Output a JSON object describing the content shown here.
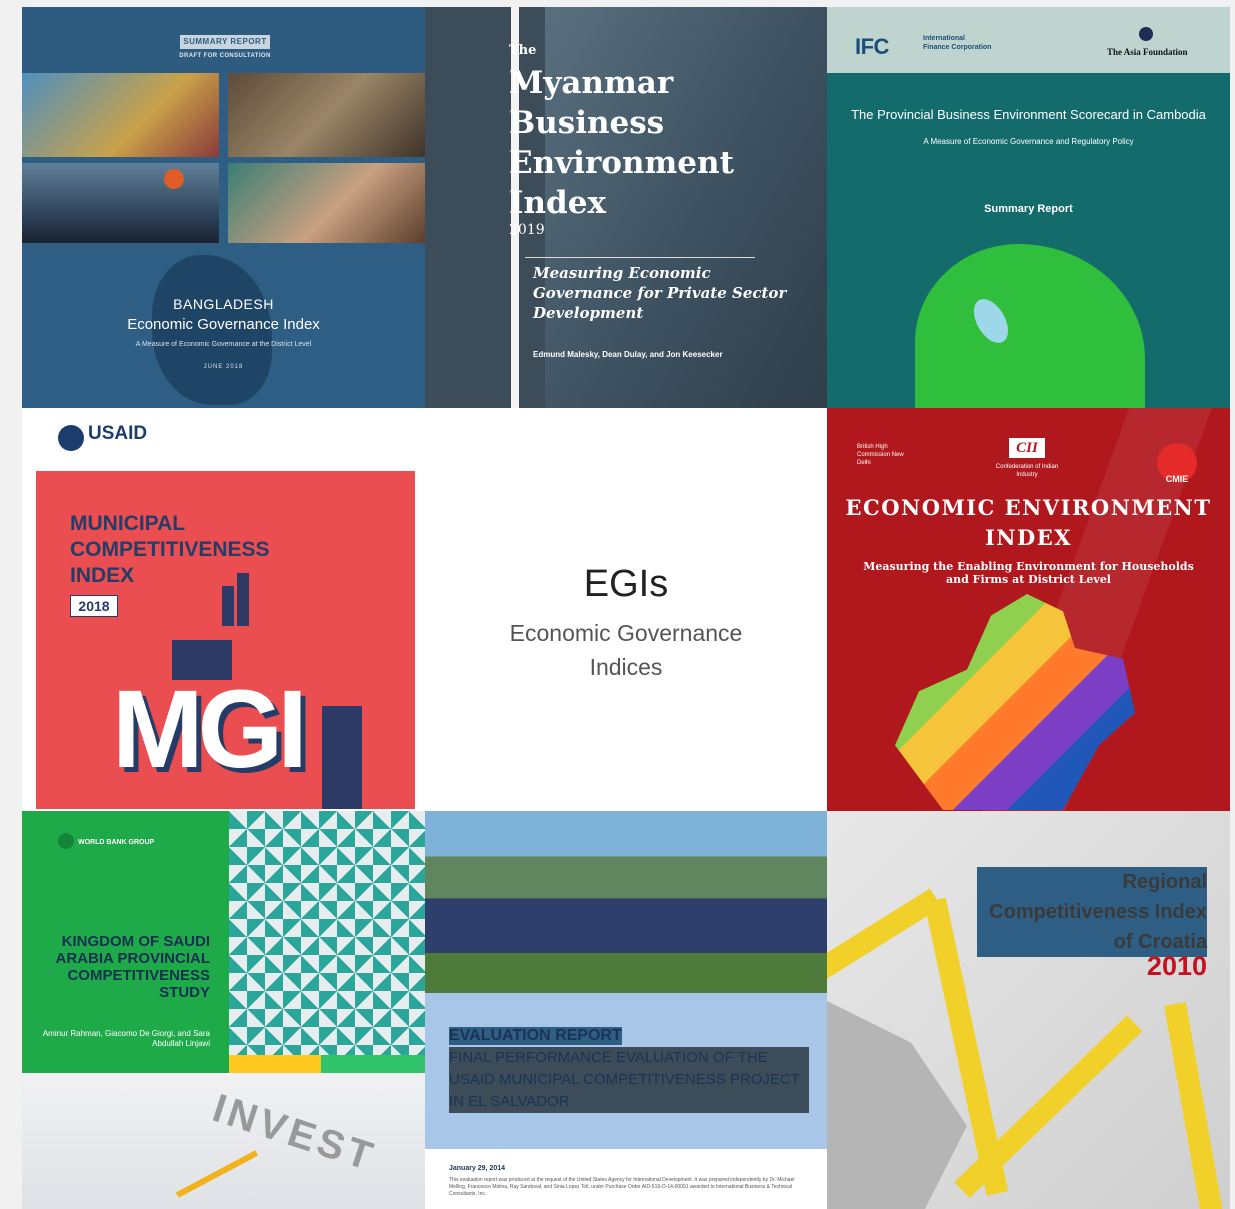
{
  "center": {
    "title": "EGIs",
    "subtitle": "Economic Governance Indices"
  },
  "tiles": {
    "bangladesh": {
      "badge": "SUMMARY REPORT",
      "draft": "DRAFT FOR CONSULTATION",
      "title1": "BANGLADESH",
      "title2": "Economic Governance Index",
      "subtitle": "A Measure of Economic Governance at the District Level",
      "date": "JUNE 2018"
    },
    "myanmar": {
      "the": "The",
      "title": "Myanmar Business Environment Index",
      "year": "2019",
      "subtitle": "Measuring Economic Governance for Private Sector Development",
      "authors": "Edmund Malesky, Dean Dulay, and Jon Keesecker"
    },
    "cambodia": {
      "ifc": "IFC",
      "ifc_full": "International Finance Corporation",
      "foundation": "The Asia Foundation",
      "title": "The Provincial Business Environment Scorecard in Cambodia",
      "subtitle": "A Measure of Economic Governance and Regulatory Policy",
      "report": "Summary Report"
    },
    "usaid_mci": {
      "logo": "USAID",
      "title": "MUNICIPAL COMPETITIVENESS INDEX",
      "year": "2018",
      "graphic": "MGI"
    },
    "cii": {
      "logo": "CII",
      "logo_sub": "Confederation of Indian Industry",
      "british": "British High Commission New Delhi",
      "cmie": "CMIE",
      "title": "ECONOMIC ENVIRONMENT INDEX",
      "subtitle": "Measuring the Enabling Environment for Households and Firms at District Level"
    },
    "saudi": {
      "org": "WORLD BANK GROUP",
      "title": "KINGDOM OF SAUDI ARABIA PROVINCIAL COMPETITIVENESS STUDY",
      "authors": "Aminur Rahman, Giacomo De Giorgi, and Sara Abdullah Linjawi",
      "invest": "INVEST"
    },
    "evaluation": {
      "heading": "EVALUATION REPORT",
      "title": "FINAL PERFORMANCE EVALUATION OF THE USAID MUNICIPAL COMPETITIVENESS PROJECT IN EL SALVADOR",
      "date": "January 29, 2014",
      "body": "This evaluation report was produced at the request of the United States Agency for International Development. It was prepared independently by Dr. Michael Melling, Francesco Molina, Ray Sandoval, and Sinia Lopez Toll, under Purchase Order AID-519-O-14-00001 awarded to International Business & Technical Consultants, Inc."
    },
    "croatia": {
      "title": "Regional Competitiveness Index of Croatia",
      "year": "2010"
    }
  }
}
